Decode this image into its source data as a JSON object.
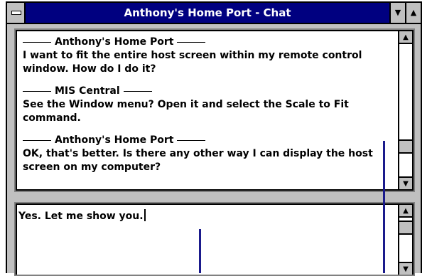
{
  "window": {
    "title": "Anthony's Home Port - Chat",
    "minimize_glyph": "▼",
    "maximize_glyph": "▲"
  },
  "transcript": {
    "messages": [
      {
        "sender": "Anthony's Home Port",
        "text": "I want to fit the entire host screen within my remote control window. How do I do it?"
      },
      {
        "sender": "MIS Central",
        "text": "See the Window menu? Open it and select the Scale to Fit command."
      },
      {
        "sender": "Anthony's Home Port",
        "text": "OK, that's better. Is there any other way I can display the host screen on my computer?"
      }
    ]
  },
  "compose": {
    "value": "Yes. Let me show you."
  },
  "scroll": {
    "up_glyph": "▲",
    "down_glyph": "▼"
  },
  "colors": {
    "titlebar": "#000080",
    "callout": "#1a1a8c",
    "face": "#c0c0c0"
  }
}
